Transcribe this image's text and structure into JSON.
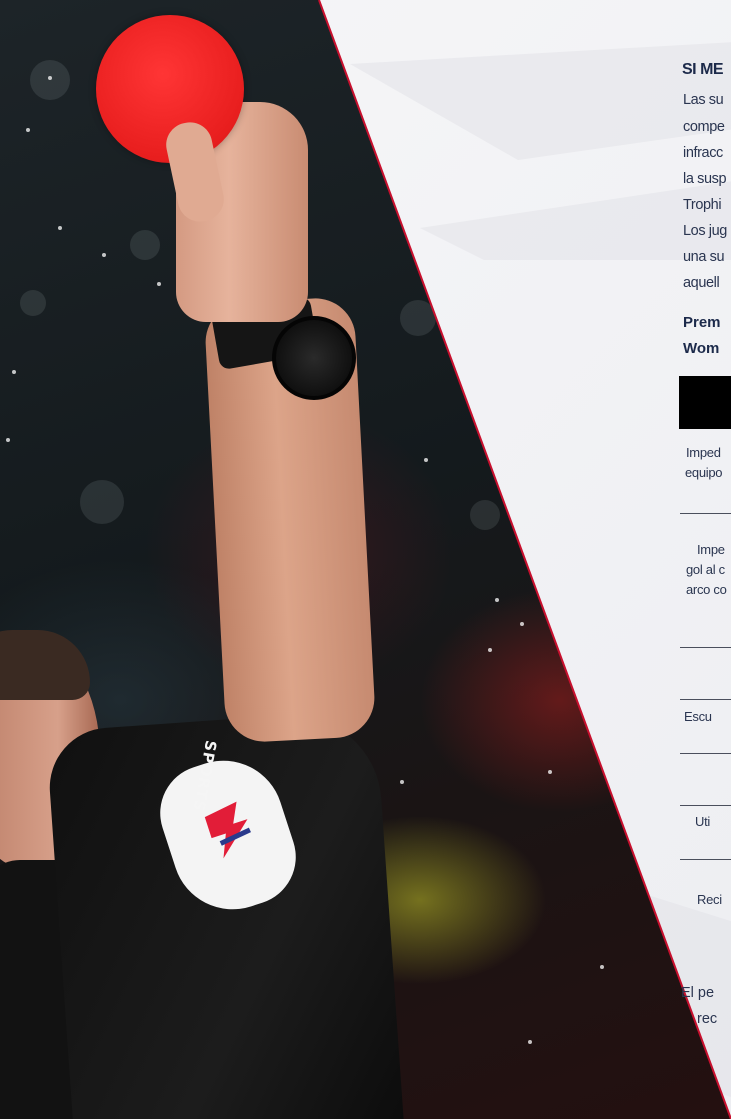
{
  "heading": "SI ME",
  "paragraph_lines": [
    "Las su",
    "compe",
    "infracc",
    "la susp",
    "Trophi",
    "Los jug",
    "una su",
    "aquell"
  ],
  "bold_lines": [
    "Prem",
    "Wom"
  ],
  "table": {
    "rows": [
      {
        "lines": [
          "Imped",
          "equipo"
        ]
      },
      {
        "lines": [
          "Impe",
          "gol al c",
          "arco co"
        ]
      },
      {
        "lines": [
          ""
        ]
      },
      {
        "lines": [
          "Escu"
        ]
      },
      {
        "lines": [
          ""
        ]
      },
      {
        "lines": [
          "Uti"
        ]
      },
      {
        "lines": [
          "Reci"
        ]
      }
    ]
  },
  "footer_lines": [
    "El pe",
    "rec"
  ],
  "badge_text": "SPORTS",
  "colors": {
    "heading": "#1c2a4a",
    "body_text": "#2a3550",
    "table_header": "#000000",
    "red_card": "#e81e1e",
    "diagonal_edge": "#c8102e"
  }
}
